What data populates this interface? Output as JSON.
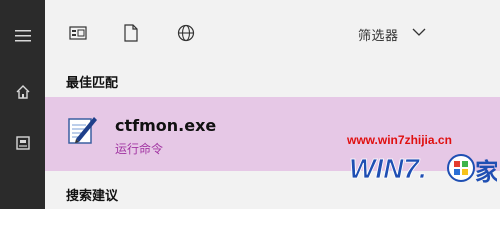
{
  "rail": {
    "items": [
      {
        "icon": "hamburger-menu-icon"
      },
      {
        "icon": "home-icon"
      },
      {
        "icon": "documents-icon"
      }
    ]
  },
  "toolbar": {
    "icons": [
      "apps-icon",
      "document-icon",
      "web-icon"
    ],
    "filter_label": "筛选器"
  },
  "sections": {
    "best_match_title": "最佳匹配",
    "search_suggestions_title": "搜索建议"
  },
  "best_match": {
    "app_name": "ctfmon.exe",
    "app_type": "运行命令",
    "highlight_color": "#e6c8e6"
  },
  "watermark": {
    "url": "www.win7zhijia.cn",
    "logo_text": "WIN7",
    "logo_suffix": "家"
  }
}
